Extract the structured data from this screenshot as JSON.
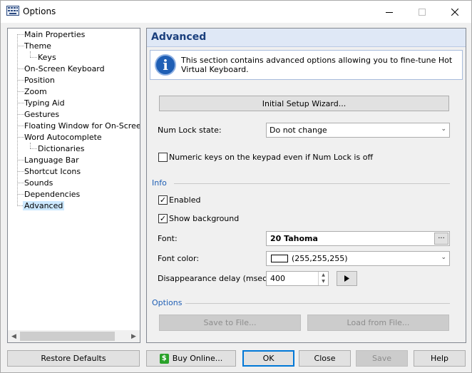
{
  "window": {
    "title": "Options"
  },
  "tree": {
    "items": [
      {
        "label": "Main Properties"
      },
      {
        "label": "Theme"
      },
      {
        "label": "Keys"
      },
      {
        "label": "On-Screen Keyboard"
      },
      {
        "label": "Position"
      },
      {
        "label": "Zoom"
      },
      {
        "label": "Typing Aid"
      },
      {
        "label": "Gestures"
      },
      {
        "label": "Floating Window for On-Screen Ke"
      },
      {
        "label": "Word Autocomplete"
      },
      {
        "label": "Dictionaries"
      },
      {
        "label": "Language Bar"
      },
      {
        "label": "Shortcut Icons"
      },
      {
        "label": "Sounds"
      },
      {
        "label": "Dependencies"
      },
      {
        "label": "Advanced"
      }
    ],
    "selected": "Advanced"
  },
  "panel": {
    "title": "Advanced",
    "info_text": "This section contains advanced options allowing you to fine-tune Hot Virtual Keyboard.",
    "wizard_button": "Initial Setup Wizard...",
    "numlock_label": "Num Lock state:",
    "numlock_value": "Do not change",
    "numeric_keys_label": "Numeric keys on the keypad even if Num Lock is off",
    "info_section": "Info",
    "enabled_label": "Enabled",
    "show_background_label": "Show background",
    "font_label": "Font:",
    "font_value": "20 Tahoma",
    "font_button": "···",
    "font_color_label": "Font color:",
    "font_color_value": "(255,255,255)",
    "delay_label": "Disappearance delay (msec):",
    "delay_value": "400",
    "options_section": "Options",
    "save_to_file": "Save to File...",
    "load_from_file": "Load from File..."
  },
  "buttons": {
    "restore_defaults": "Restore Defaults",
    "buy_online": "Buy Online...",
    "ok": "OK",
    "close": "Close",
    "save": "Save",
    "help": "Help"
  },
  "colors": {
    "accent": "#1f5fb5",
    "selection": "#cce8ff",
    "header_bg": "#dfe8f6"
  }
}
